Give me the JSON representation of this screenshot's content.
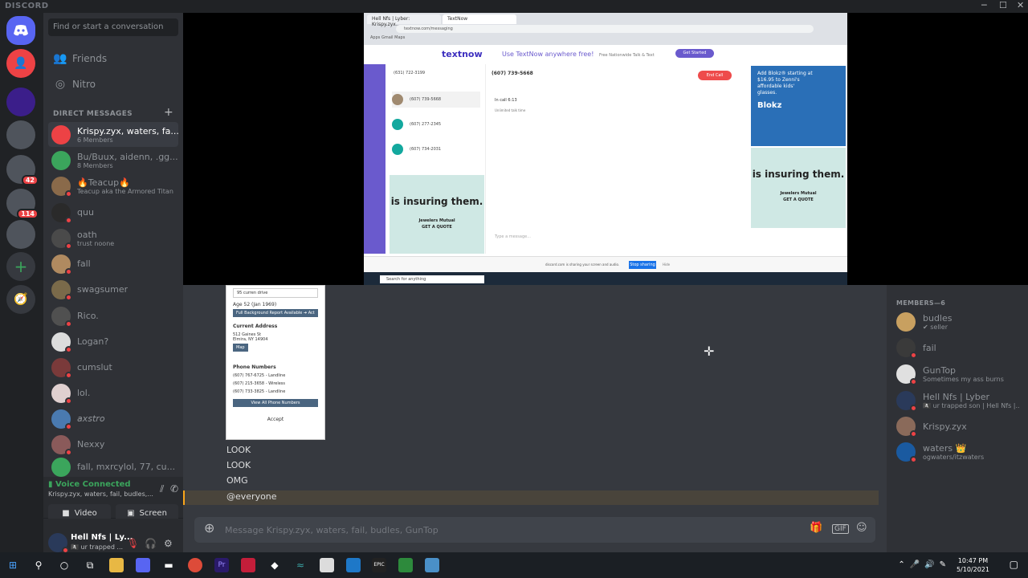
{
  "app": {
    "title": "DISCORD",
    "win_min": "─",
    "win_max": "☐",
    "win_close": "✕"
  },
  "guilds": [
    {
      "name": "home",
      "icon": "discord-logo",
      "color": "#5865f2"
    },
    {
      "name": "friends-request",
      "icon": "person-add",
      "color": "#ed4245"
    },
    {
      "name": "server-purple",
      "color": "#3b1e8a"
    },
    {
      "name": "server-group-1",
      "color": "#4f545c"
    },
    {
      "name": "server-group-2",
      "color": "#4f545c",
      "badge": "42"
    },
    {
      "name": "server-group-3",
      "color": "#4f545c",
      "badge": "114"
    },
    {
      "name": "server-group-4",
      "color": "#4f545c"
    }
  ],
  "sidebar": {
    "search_placeholder": "Find or start a conversation",
    "friends": "Friends",
    "nitro": "Nitro",
    "dm_header": "DIRECT MESSAGES",
    "dm_add": "+",
    "dms": [
      {
        "name": "Krispy.zyx, waters, fa...",
        "sub": "6 Members",
        "color": "#ed4245",
        "selected": true
      },
      {
        "name": "Bu/Buux, aidenn, .gg...",
        "sub": "8 Members",
        "color": "#3ba55c"
      },
      {
        "name": "🔥Teacup🔥",
        "sub": "Teacup aka the Armored Titan",
        "color": "#8a6a4a"
      },
      {
        "name": "quu",
        "sub": "",
        "color": "#2a2a2a"
      },
      {
        "name": "oath",
        "sub": "trust noone",
        "color": "#4a4a4a"
      },
      {
        "name": "fall",
        "sub": "",
        "color": "#b08a60"
      },
      {
        "name": "swagsumer",
        "sub": "",
        "color": "#7a6a4a"
      },
      {
        "name": "Rico.",
        "sub": "",
        "color": "#505050"
      },
      {
        "name": "Logan?",
        "sub": "",
        "color": "#dcdcdc"
      },
      {
        "name": "cumslut",
        "sub": "",
        "color": "#7a3a3a"
      },
      {
        "name": "lol.",
        "sub": "",
        "color": "#e0d0d0"
      },
      {
        "name": "𝘢𝘹𝘴𝘵𝘳𝘰",
        "sub": "",
        "color": "#4a7ab0"
      },
      {
        "name": "Nexxy",
        "sub": "",
        "color": "#8a5a5a"
      },
      {
        "name": "fall, mxrcylol, 77, cu...",
        "sub": "",
        "color": "#3ba55c"
      }
    ],
    "voice": {
      "status": "Voice Connected",
      "channel": "Krispy.zyx, waters, fail, budles,...",
      "video": "Video",
      "screen": "Screen"
    },
    "user": {
      "name": "Hell Nfs | Ly...",
      "sub": "🏴‍☠️ ur trapped ..."
    }
  },
  "stream": {
    "tabs": [
      "Hell Nfs | Lyber: Krispy.zyx...",
      "TextNow"
    ],
    "url": "textnow.com/messaging",
    "bookmarks": "Apps   Gmail   Maps",
    "logo": "textnow",
    "promo": "Use TextNow anywhere free!",
    "promo2": "Free Nationwide Talk & Text",
    "get_started": "Get Started",
    "my_number": "(631) 722-3199",
    "call_number": "(607) 739-5668",
    "end_call": "End Call",
    "in_call": "In call 6:13",
    "in_call_sub": "Unlimited talk time",
    "contacts": [
      "(607) 739-5668",
      "(607) 277-2345",
      "(607) 734-2031"
    ],
    "ad_title": "is insuring them.",
    "ad_brand": "Jewelers Mutual",
    "ad_cta": "GET A QUOTE",
    "blokz_text": "Add Blokz® starting at $16.95 to Zenni's affordable kids' glasses.",
    "blokz_brand": "Blokz",
    "share_text": "discord.com is sharing your screen and audio.",
    "stop_sharing": "Stop sharing",
    "hide": "Hide",
    "taskbar_search": "Search for anything",
    "message_ph": "Type a message..."
  },
  "embed": {
    "search": "95 curren drive",
    "age": "Age 52 (Jan 1969)",
    "report": "Full Background Report Available ➔ Act",
    "addr_h": "Current Address",
    "addr": "512 Gaines St\nElmira, NY 14904",
    "map": "Map",
    "phones_h": "Phone Numbers",
    "phones": [
      "(607) 767-6725 - Landline",
      "(607) 215-3658 - Wireless",
      "(607) 733-3825 - Landline"
    ],
    "view_all": "View All Phone Numbers",
    "accept": "Accept"
  },
  "messages": [
    "LOOK",
    "LOOK",
    "OMG",
    "@everyone"
  ],
  "composer": {
    "placeholder": "Message Krispy.zyx, waters, fail, budles, GunTop"
  },
  "members": {
    "header": "MEMBERS—6",
    "list": [
      {
        "name": "budles",
        "sub": "✔ seller",
        "color": "#c8a060"
      },
      {
        "name": "fail",
        "sub": "",
        "color": "#3a3a3a"
      },
      {
        "name": "GunTop",
        "sub": "Sometimes my ass burns",
        "color": "#e0e0e0"
      },
      {
        "name": "Hell Nfs | Lyber",
        "sub": "🏴‍☠️ ur trapped son | Hell Nfs |...",
        "color": "#2a3a5a"
      },
      {
        "name": "Krispy.zyx",
        "sub": "",
        "color": "#8a6a5a"
      },
      {
        "name": "waters 👑",
        "sub": "ogwaters/itzwaters",
        "color": "#1a5aa0"
      }
    ]
  },
  "taskbar": {
    "time": "10:47 PM",
    "date": "5/10/2021"
  }
}
